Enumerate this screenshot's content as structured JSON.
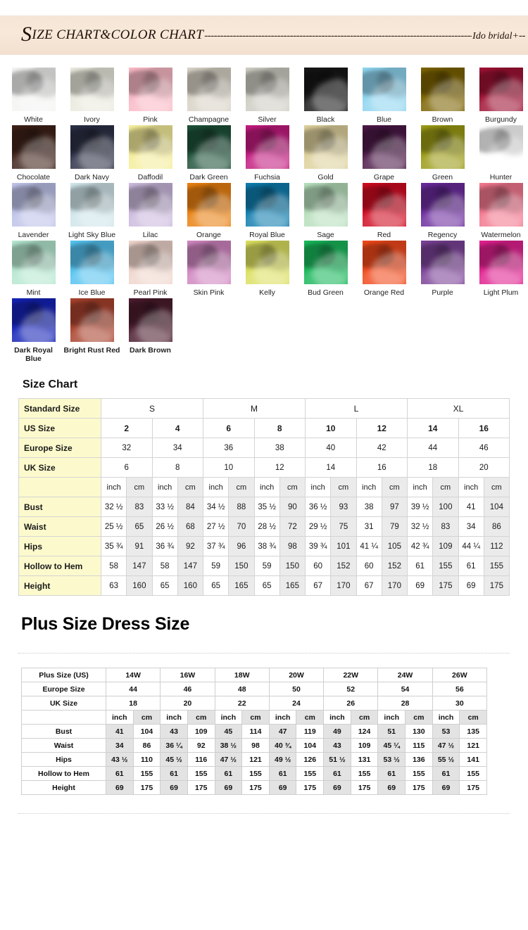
{
  "header": {
    "title_first_letter": "S",
    "title_rest": "ize chart&color chart",
    "dash_run": "-----------------------------------------------------------------------------------------------",
    "brand": "Ido bridal+",
    "tail_dashes": "--",
    "band_color": "#f5e5d5"
  },
  "colors": {
    "rows": [
      [
        {
          "name": "White",
          "hex": "#f4f4f2"
        },
        {
          "name": "Ivory",
          "hex": "#e9e9dd"
        },
        {
          "name": "Pink",
          "hex": "#f9b8c4"
        },
        {
          "name": "Champagne",
          "hex": "#d8d2c5"
        },
        {
          "name": "Silver",
          "hex": "#cdccc2"
        },
        {
          "name": "Black",
          "hex": "#161616"
        },
        {
          "name": "Blue",
          "hex": "#8ed4ef"
        },
        {
          "name": "Brown",
          "hex": "#7b6200"
        },
        {
          "name": "Burgundy",
          "hex": "#9e1133"
        }
      ],
      [
        {
          "name": "Chocolate",
          "hex": "#3d2017"
        },
        {
          "name": "Dark Navy",
          "hex": "#2b2f45"
        },
        {
          "name": "Daffodil",
          "hex": "#f5ed9a"
        },
        {
          "name": "Dark Green",
          "hex": "#1d5038"
        },
        {
          "name": "Fuchsia",
          "hex": "#c21a7e"
        },
        {
          "name": "Gold",
          "hex": "#ddd09b"
        },
        {
          "name": "Grape",
          "hex": "#4a1746"
        },
        {
          "name": "Green",
          "hex": "#9a9a14"
        },
        {
          "name": "Hunter",
          "hex": "#1eb униц"
        }
      ],
      [
        {
          "name": "Lavender",
          "hex": "#bdc2e8"
        },
        {
          "name": "Light Sky Blue",
          "hex": "#cfe5ea"
        },
        {
          "name": "Lilac",
          "hex": "#cbb9dd"
        },
        {
          "name": "Orange",
          "hex": "#e98010"
        },
        {
          "name": "Royal Blue",
          "hex": "#0f7cae"
        },
        {
          "name": "Sage",
          "hex": "#b6debb"
        },
        {
          "name": "Red",
          "hex": "#cf0a20"
        },
        {
          "name": "Regency",
          "hex": "#6a2a9c"
        },
        {
          "name": "Watermelon",
          "hex": "#f2778e"
        }
      ],
      [
        {
          "name": "Mint",
          "hex": "#b4e7cf"
        },
        {
          "name": "Ice Blue",
          "hex": "#54c2ef"
        },
        {
          "name": "Pearl Pink",
          "hex": "#efd5cc"
        },
        {
          "name": "Skin Pink",
          "hex": "#cf85c0"
        },
        {
          "name": "Kelly",
          "hex": "#dbdf5e"
        },
        {
          "name": "Bud Green",
          "hex": "#18b75a"
        },
        {
          "name": "Orange Red",
          "hex": "#f0481a"
        },
        {
          "name": "Purple",
          "hex": "#7a4196"
        },
        {
          "name": "Light Plum",
          "hex": "#e0208f"
        }
      ],
      [
        {
          "name": "Dark Royal Blue",
          "hex": "#1422b6"
        },
        {
          "name": "Bright Rust Red",
          "hex": "#a8412c"
        },
        {
          "name": "Dark Brown",
          "hex": "#4a1b2c"
        }
      ]
    ]
  },
  "size_chart": {
    "heading": "Size Chart",
    "label_standard_size": "Standard Size",
    "groups": [
      "S",
      "M",
      "L",
      "XL"
    ],
    "rows_simple": [
      {
        "label": "US Size",
        "values": [
          "2",
          "4",
          "6",
          "8",
          "10",
          "12",
          "14",
          "16"
        ],
        "bold": true
      },
      {
        "label": "Europe Size",
        "values": [
          "32",
          "34",
          "36",
          "38",
          "40",
          "42",
          "44",
          "46"
        ],
        "bold": false
      },
      {
        "label": "UK Size",
        "values": [
          "6",
          "8",
          "10",
          "12",
          "14",
          "16",
          "18",
          "20"
        ],
        "bold": false
      }
    ],
    "unit_label_inch": "inch",
    "unit_label_cm": "cm",
    "rows_measure": [
      {
        "label": "Bust",
        "values": [
          "32 ½",
          "83",
          "33 ½",
          "84",
          "34 ½",
          "88",
          "35 ½",
          "90",
          "36 ½",
          "93",
          "38",
          "97",
          "39 ½",
          "100",
          "41",
          "104"
        ]
      },
      {
        "label": "Waist",
        "values": [
          "25 ½",
          "65",
          "26 ½",
          "68",
          "27 ½",
          "70",
          "28 ½",
          "72",
          "29 ½",
          "75",
          "31",
          "79",
          "32 ½",
          "83",
          "34",
          "86"
        ]
      },
      {
        "label": "Hips",
        "values": [
          "35 ¾",
          "91",
          "36 ¾",
          "92",
          "37 ¾",
          "96",
          "38 ¾",
          "98",
          "39 ¾",
          "101",
          "41 ¼",
          "105",
          "42 ¾",
          "109",
          "44 ¼",
          "112"
        ]
      },
      {
        "label": "Hollow to Hem",
        "values": [
          "58",
          "147",
          "58",
          "147",
          "59",
          "150",
          "59",
          "150",
          "60",
          "152",
          "60",
          "152",
          "61",
          "155",
          "61",
          "155"
        ]
      },
      {
        "label": "Height",
        "values": [
          "63",
          "160",
          "65",
          "160",
          "65",
          "165",
          "65",
          "165",
          "67",
          "170",
          "67",
          "170",
          "69",
          "175",
          "69",
          "175"
        ]
      }
    ]
  },
  "plus_size": {
    "heading": "Plus Size Dress Size",
    "rows_simple": [
      {
        "label": "Plus Size (US)",
        "values": [
          "14W",
          "16W",
          "18W",
          "20W",
          "22W",
          "24W",
          "26W"
        ]
      },
      {
        "label": "Europe Size",
        "values": [
          "44",
          "46",
          "48",
          "50",
          "52",
          "54",
          "56"
        ]
      },
      {
        "label": "UK Size",
        "values": [
          "18",
          "20",
          "22",
          "24",
          "26",
          "28",
          "30"
        ]
      }
    ],
    "unit_label_inch": "inch",
    "unit_label_cm": "cm",
    "rows_measure": [
      {
        "label": "Bust",
        "values": [
          "41",
          "104",
          "43",
          "109",
          "45",
          "114",
          "47",
          "119",
          "49",
          "124",
          "51",
          "130",
          "53",
          "135"
        ]
      },
      {
        "label": "Waist",
        "values": [
          "34",
          "86",
          "36 ¼",
          "92",
          "38 ½",
          "98",
          "40 ¾",
          "104",
          "43",
          "109",
          "45 ¼",
          "115",
          "47 ½",
          "121"
        ]
      },
      {
        "label": "Hips",
        "values": [
          "43 ½",
          "110",
          "45 ½",
          "116",
          "47 ½",
          "121",
          "49 ½",
          "126",
          "51 ½",
          "131",
          "53 ½",
          "136",
          "55 ½",
          "141"
        ]
      },
      {
        "label": "Hollow to Hem",
        "values": [
          "61",
          "155",
          "61",
          "155",
          "61",
          "155",
          "61",
          "155",
          "61",
          "155",
          "61",
          "155",
          "61",
          "155"
        ]
      },
      {
        "label": "Height",
        "values": [
          "69",
          "175",
          "69",
          "175",
          "69",
          "175",
          "69",
          "175",
          "69",
          "175",
          "69",
          "175",
          "69",
          "175"
        ]
      }
    ]
  }
}
